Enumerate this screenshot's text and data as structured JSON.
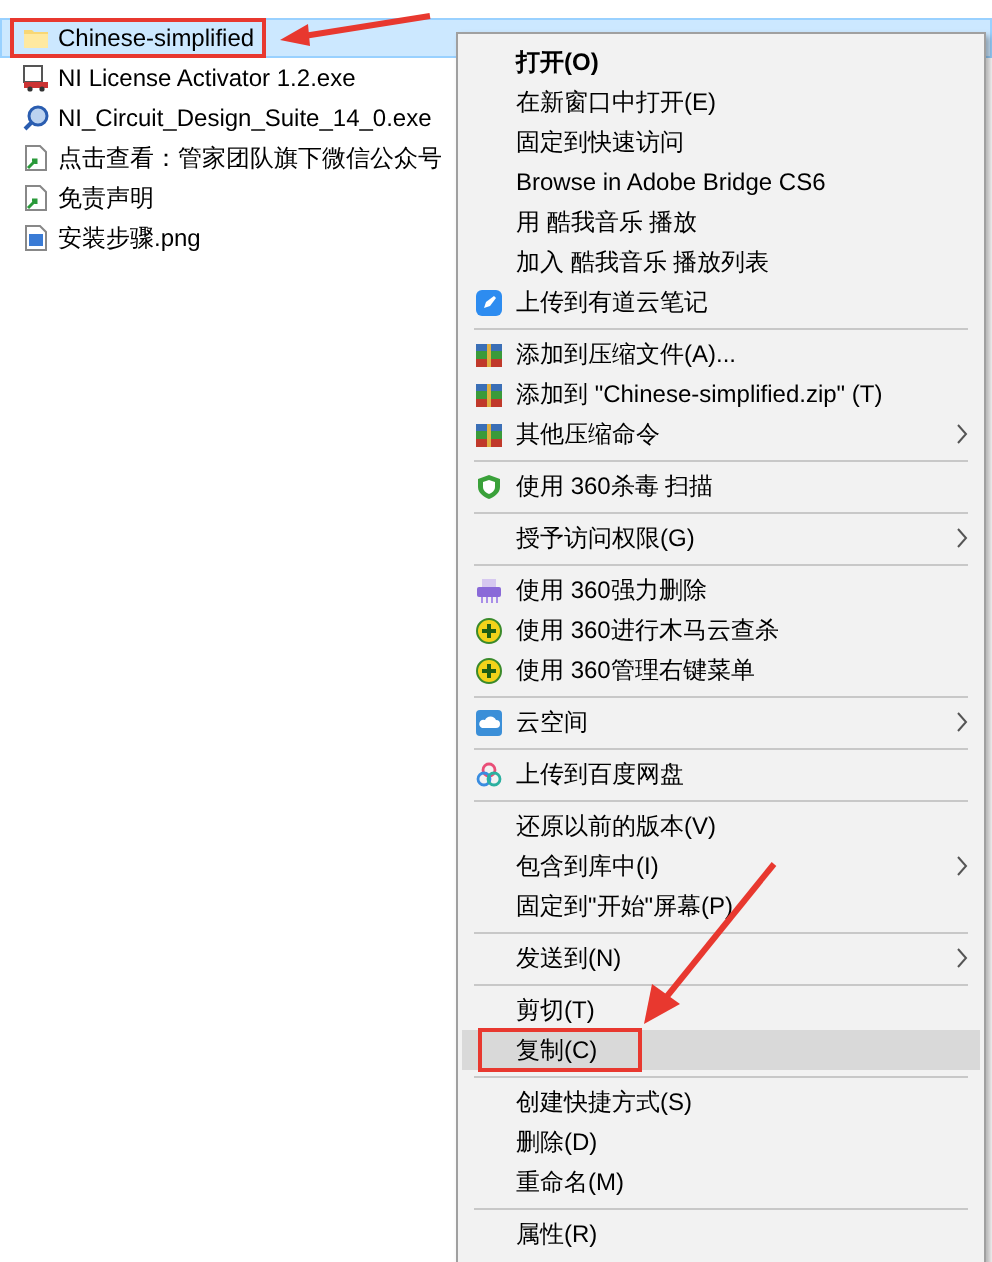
{
  "files": [
    {
      "name": "Chinese-simplified",
      "kind": "folder",
      "selected": true,
      "annotated": true
    },
    {
      "name": "NI License Activator 1.2.exe",
      "kind": "application",
      "selected": false,
      "annotated": false
    },
    {
      "name": "NI_Circuit_Design_Suite_14_0.exe",
      "kind": "installer",
      "selected": false,
      "annotated": false
    },
    {
      "name": "点击查看：管家团队旗下微信公众号",
      "kind": "shortcut",
      "selected": false,
      "annotated": false
    },
    {
      "name": "免责声明",
      "kind": "shortcut",
      "selected": false,
      "annotated": false
    },
    {
      "name": "安装步骤.png",
      "kind": "image",
      "selected": false,
      "annotated": false
    }
  ],
  "context_menu": [
    {
      "kind": "item",
      "label": "打开(O)",
      "bold": true,
      "selected": false
    },
    {
      "kind": "item",
      "label": "在新窗口中打开(E)",
      "selected": false
    },
    {
      "kind": "item",
      "label": "固定到快速访问",
      "selected": false
    },
    {
      "kind": "item",
      "label": "Browse in Adobe Bridge CS6",
      "selected": false
    },
    {
      "kind": "item",
      "label": "用 酷我音乐 播放",
      "selected": false
    },
    {
      "kind": "item",
      "label": "加入 酷我音乐 播放列表",
      "selected": false
    },
    {
      "kind": "item",
      "label": "上传到有道云笔记",
      "selected": false
    },
    {
      "kind": "separator"
    },
    {
      "kind": "item",
      "label": "添加到压缩文件(A)...",
      "selected": false
    },
    {
      "kind": "item",
      "label": "添加到 \"Chinese-simplified.zip\" (T)",
      "selected": false
    },
    {
      "kind": "item",
      "label": "其他压缩命令",
      "submenu": true,
      "selected": false
    },
    {
      "kind": "separator"
    },
    {
      "kind": "item",
      "label": "使用 360杀毒 扫描",
      "selected": false
    },
    {
      "kind": "separator"
    },
    {
      "kind": "item",
      "label": "授予访问权限(G)",
      "submenu": true,
      "selected": false
    },
    {
      "kind": "separator"
    },
    {
      "kind": "item",
      "label": "使用 360强力删除",
      "selected": false
    },
    {
      "kind": "item",
      "label": "使用 360进行木马云查杀",
      "selected": false
    },
    {
      "kind": "item",
      "label": "使用 360管理右键菜单",
      "selected": false
    },
    {
      "kind": "separator"
    },
    {
      "kind": "item",
      "label": "云空间",
      "submenu": true,
      "selected": false
    },
    {
      "kind": "separator"
    },
    {
      "kind": "item",
      "label": "上传到百度网盘",
      "selected": false
    },
    {
      "kind": "separator"
    },
    {
      "kind": "item",
      "label": "还原以前的版本(V)",
      "selected": false
    },
    {
      "kind": "item",
      "label": "包含到库中(I)",
      "submenu": true,
      "selected": false
    },
    {
      "kind": "item",
      "label": "固定到\"开始\"屏幕(P)",
      "selected": false
    },
    {
      "kind": "separator"
    },
    {
      "kind": "item",
      "label": "发送到(N)",
      "submenu": true,
      "selected": false
    },
    {
      "kind": "separator"
    },
    {
      "kind": "item",
      "label": "剪切(T)",
      "selected": false
    },
    {
      "kind": "item",
      "label": "复制(C)",
      "selected": true,
      "annotated": true
    },
    {
      "kind": "separator"
    },
    {
      "kind": "item",
      "label": "创建快捷方式(S)",
      "selected": false
    },
    {
      "kind": "item",
      "label": "删除(D)",
      "selected": false
    },
    {
      "kind": "item",
      "label": "重命名(M)",
      "selected": false
    },
    {
      "kind": "separator"
    },
    {
      "kind": "item",
      "label": "属性(R)",
      "selected": false
    }
  ]
}
